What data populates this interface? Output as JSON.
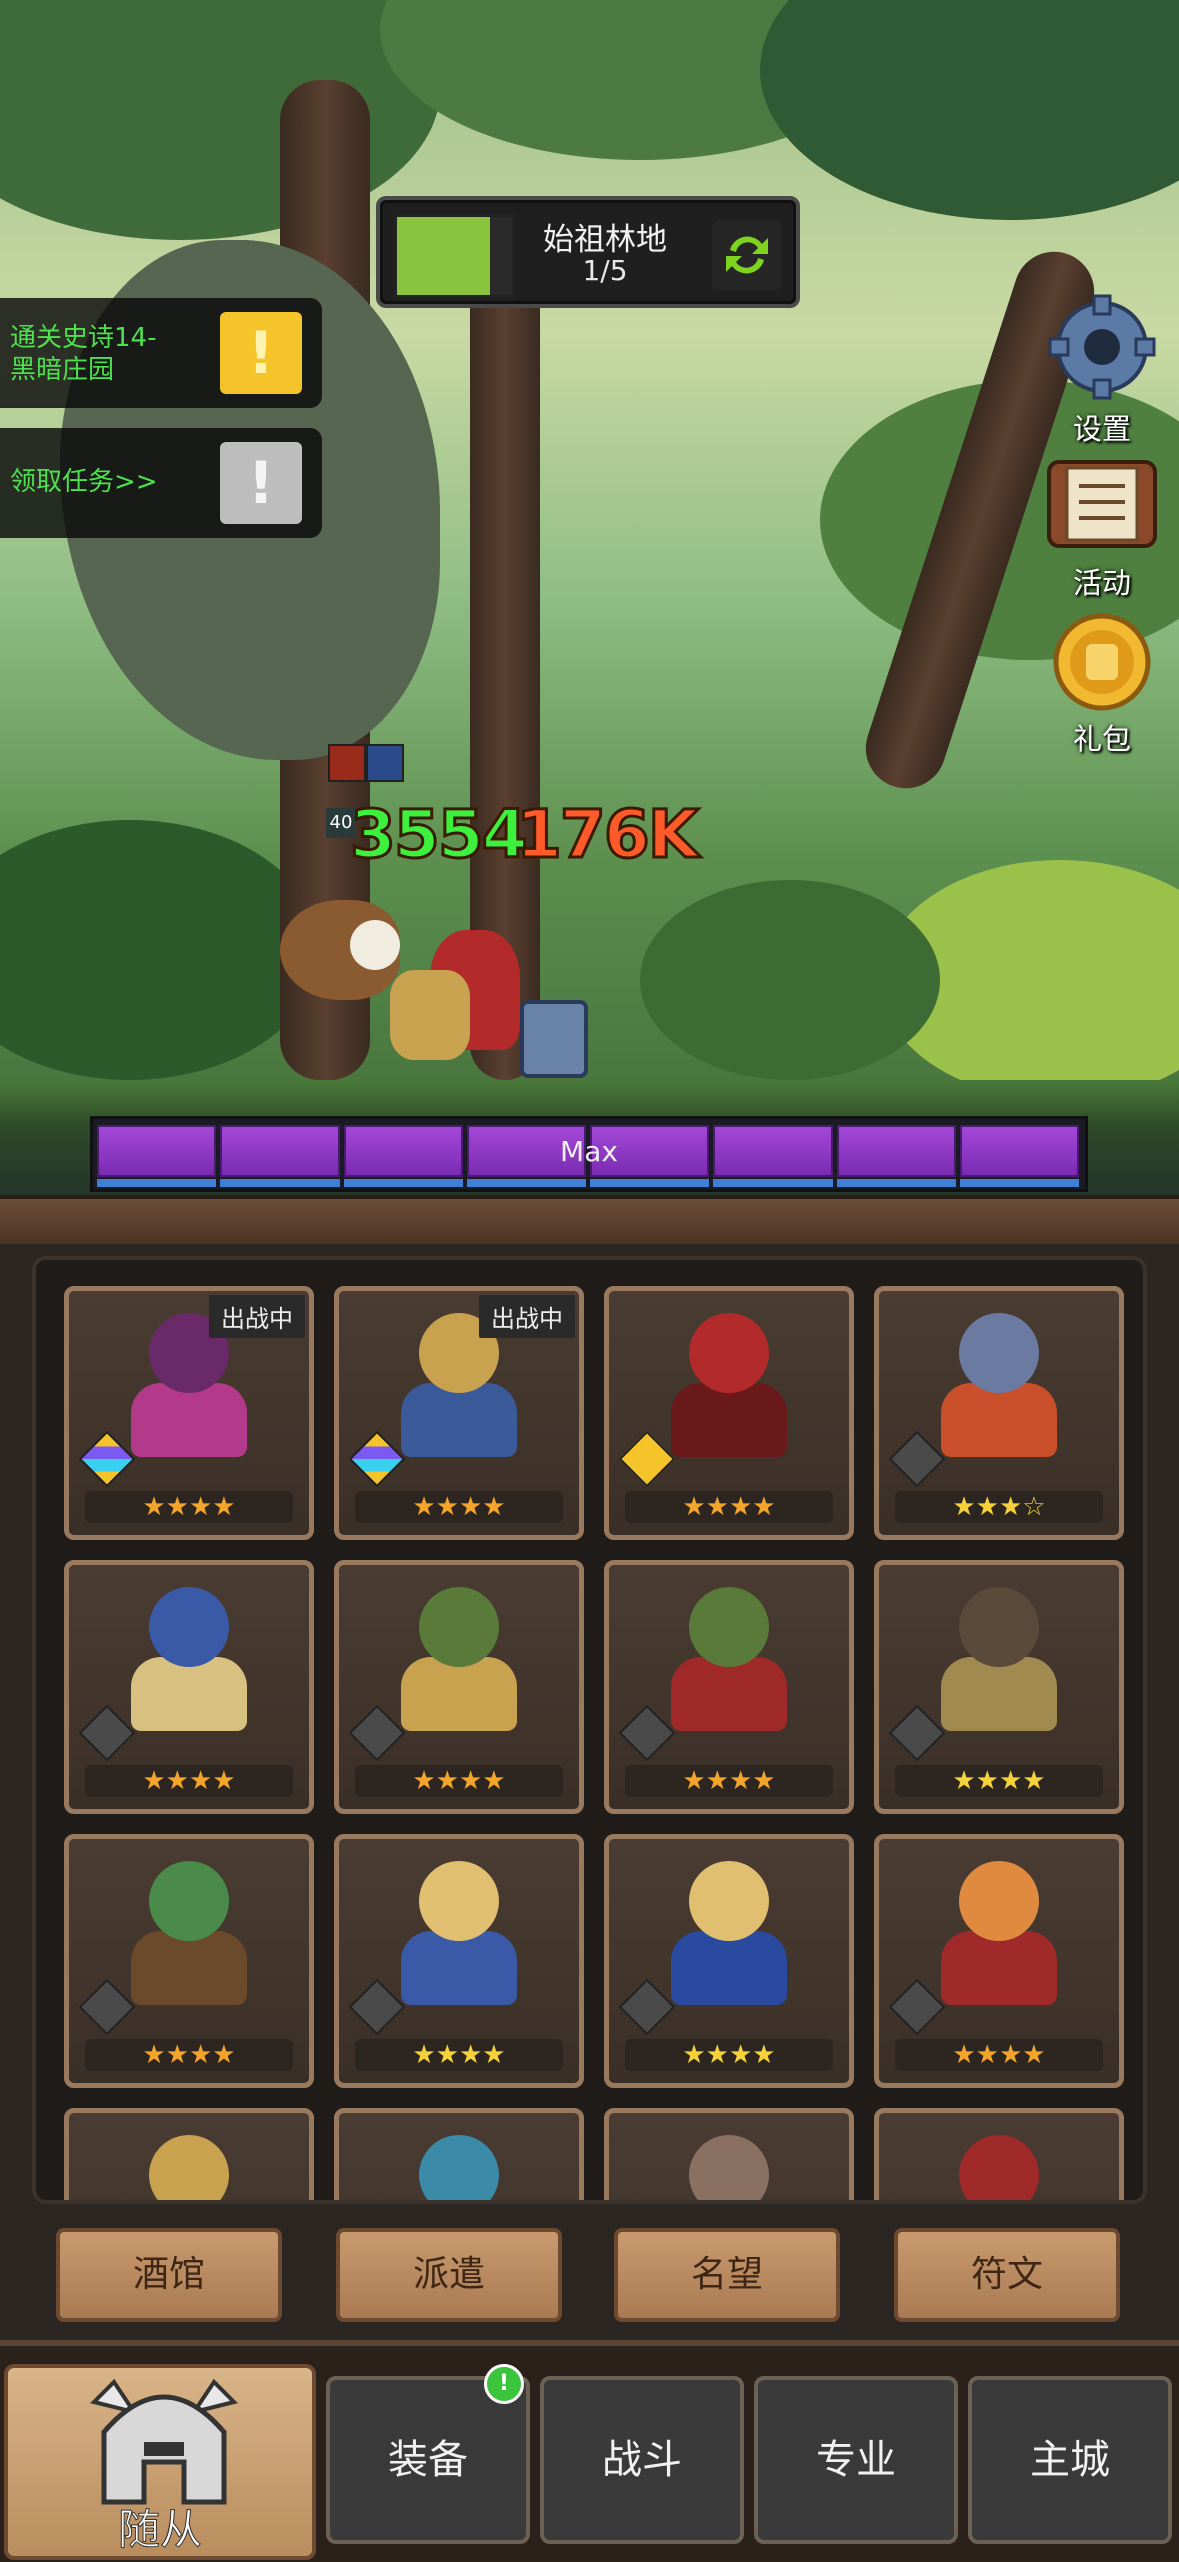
{
  "zone": {
    "name": "始祖林地",
    "progress": "1/5",
    "fill_fraction": 0.2
  },
  "quests": [
    {
      "text_line1": "通关史诗14-",
      "text_line2": "黑暗庄园",
      "badge": "!",
      "badge_color": "#f5c32a"
    },
    {
      "text_line1": "领取任务>>",
      "text_line2": "",
      "badge": "!",
      "badge_color": "#bdbdbd"
    }
  ],
  "side_buttons": {
    "settings": "设置",
    "activity": "活动",
    "gift": "礼包"
  },
  "combat": {
    "heal": "3554",
    "damage": "176K",
    "heal_color": "#3df03d",
    "damage_color": "#ff5a2a",
    "small_tag": "40"
  },
  "max_bar": {
    "label": "Max",
    "segments": 8
  },
  "roster": [
    {
      "tag": "出战中",
      "stars": "★★★★",
      "rarity": "multi",
      "colors": [
        "#6a2a6a",
        "#b33a8a"
      ]
    },
    {
      "tag": "出战中",
      "stars": "★★★★",
      "rarity": "multi",
      "colors": [
        "#c9a250",
        "#3a5a9a"
      ]
    },
    {
      "tag": "",
      "stars": "★★★★",
      "rarity": "gold",
      "colors": [
        "#b32a2a",
        "#6a1a1a"
      ]
    },
    {
      "tag": "",
      "stars": "★★★☆",
      "rarity": "grey",
      "colors": [
        "#6a7aa0",
        "#c9502a"
      ],
      "gold_stars": true
    },
    {
      "tag": "",
      "stars": "★★★★",
      "rarity": "grey",
      "colors": [
        "#3a5aa8",
        "#d8c080"
      ]
    },
    {
      "tag": "",
      "stars": "★★★★",
      "rarity": "grey",
      "colors": [
        "#5a7a3a",
        "#c9a250"
      ]
    },
    {
      "tag": "",
      "stars": "★★★★",
      "rarity": "grey",
      "colors": [
        "#5a7a3a",
        "#a02a2a"
      ]
    },
    {
      "tag": "",
      "stars": "★★★★",
      "rarity": "grey",
      "colors": [
        "#5a4a3a",
        "#a08a50"
      ],
      "gold_stars": true
    },
    {
      "tag": "",
      "stars": "★★★★",
      "rarity": "grey",
      "colors": [
        "#4a8a4a",
        "#6a4a2a"
      ]
    },
    {
      "tag": "",
      "stars": "★★★★",
      "rarity": "grey",
      "colors": [
        "#e0c070",
        "#3a5aa8"
      ],
      "gold_stars": true
    },
    {
      "tag": "",
      "stars": "★★★★",
      "rarity": "grey",
      "colors": [
        "#e0c070",
        "#2a4aa0"
      ],
      "gold_stars": true
    },
    {
      "tag": "",
      "stars": "★★★★",
      "rarity": "grey",
      "colors": [
        "#e08a40",
        "#a02a2a"
      ]
    },
    {
      "tag": "",
      "stars": "",
      "rarity": "none",
      "colors": [
        "#c9a250",
        "#5a4030"
      ]
    },
    {
      "tag": "",
      "stars": "",
      "rarity": "none",
      "colors": [
        "#3a8aa8",
        "#c9602a"
      ]
    },
    {
      "tag": "",
      "stars": "",
      "rarity": "none",
      "colors": [
        "#8a7060",
        "#5a4a40"
      ]
    },
    {
      "tag": "",
      "stars": "",
      "rarity": "none",
      "colors": [
        "#a02a2a",
        "#3a3a3a"
      ]
    }
  ],
  "menu": {
    "tavern": "酒馆",
    "dispatch": "派遣",
    "reputation": "名望",
    "rune": "符文"
  },
  "nav": {
    "followers": "随从",
    "equipment": "装备",
    "battle": "战斗",
    "profession": "专业",
    "main_city": "主城",
    "equipment_notif": "!"
  }
}
